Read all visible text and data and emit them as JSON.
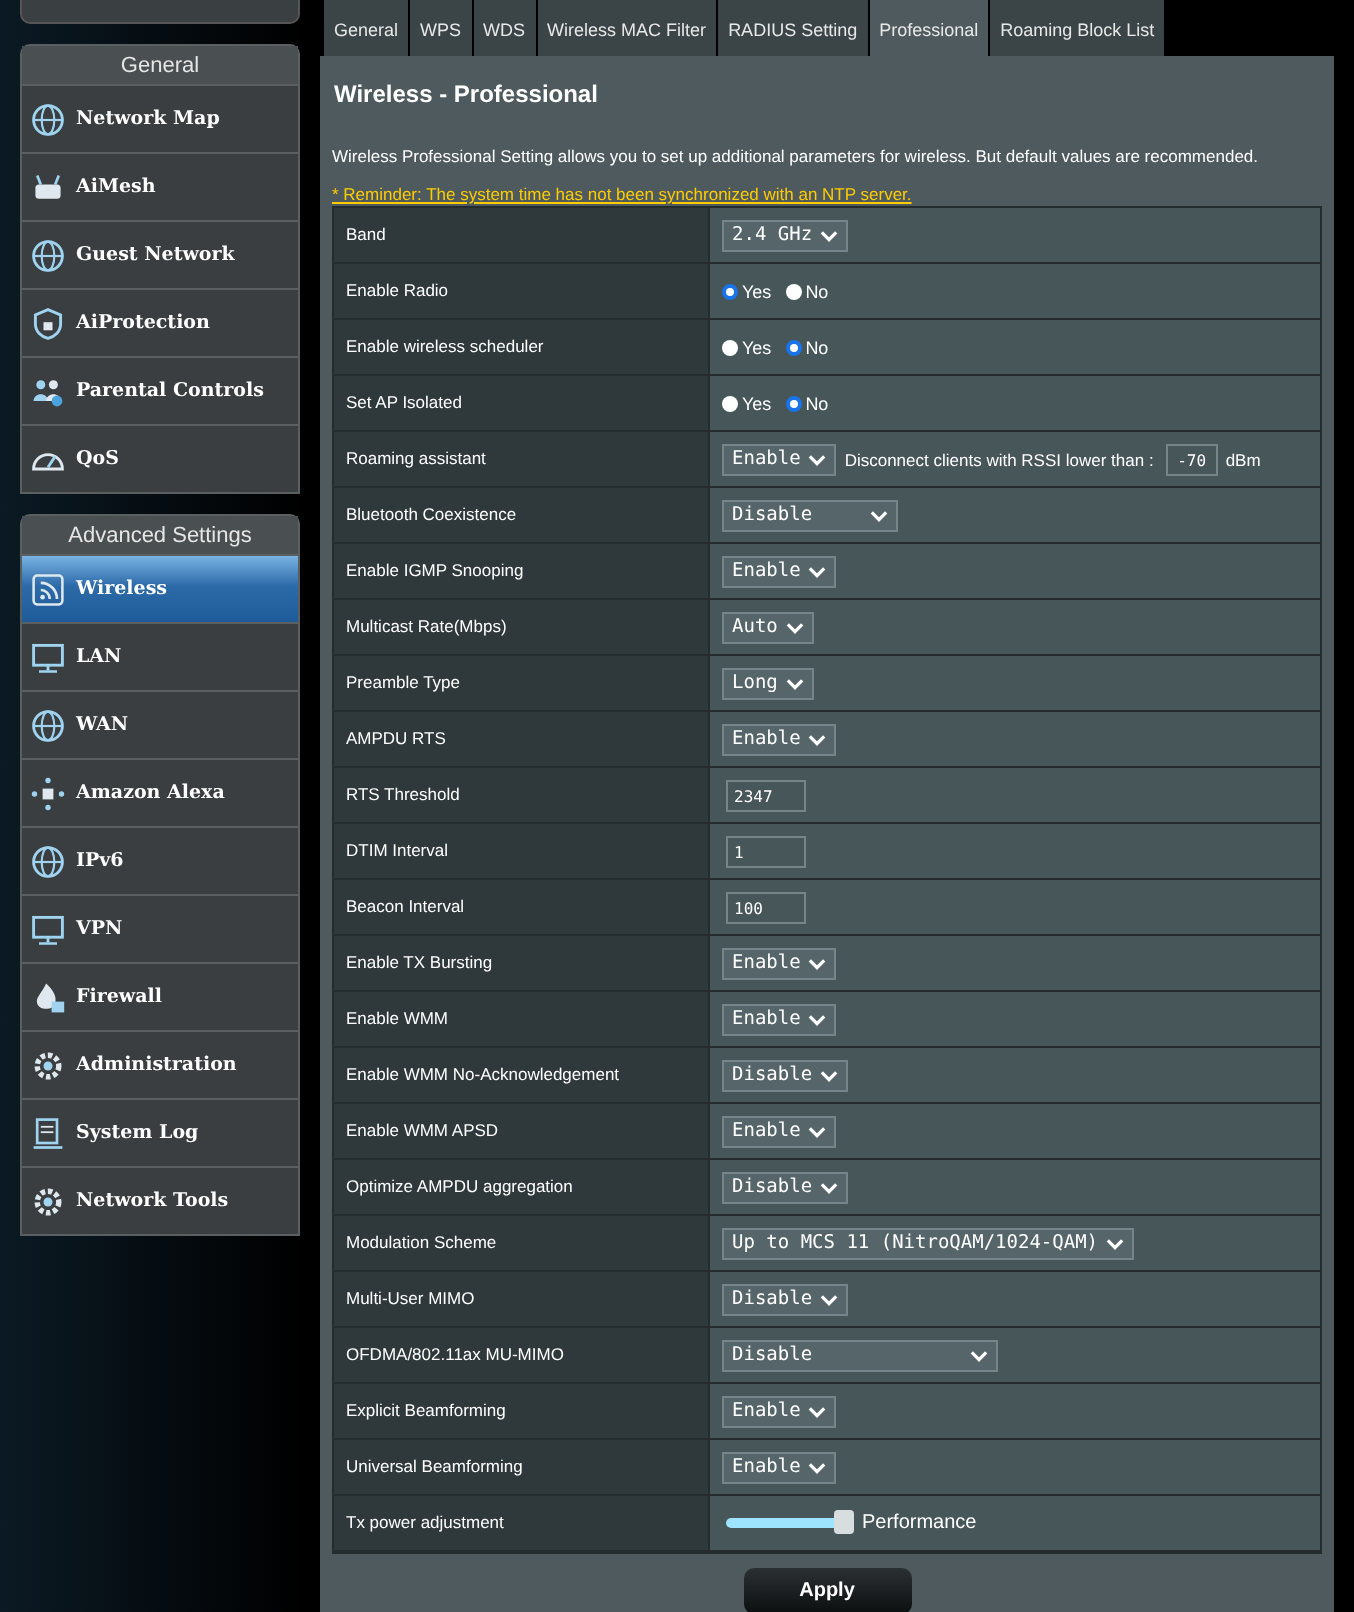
{
  "sidebar": {
    "groups": [
      {
        "title": "General",
        "items": [
          {
            "label": "Network Map",
            "selected": false
          },
          {
            "label": "AiMesh",
            "selected": false
          },
          {
            "label": "Guest Network",
            "selected": false
          },
          {
            "label": "AiProtection",
            "selected": false
          },
          {
            "label": "Parental Controls",
            "selected": false
          },
          {
            "label": "QoS",
            "selected": false
          }
        ]
      },
      {
        "title": "Advanced Settings",
        "items": [
          {
            "label": "Wireless",
            "selected": true
          },
          {
            "label": "LAN",
            "selected": false
          },
          {
            "label": "WAN",
            "selected": false
          },
          {
            "label": "Amazon Alexa",
            "selected": false
          },
          {
            "label": "IPv6",
            "selected": false
          },
          {
            "label": "VPN",
            "selected": false
          },
          {
            "label": "Firewall",
            "selected": false
          },
          {
            "label": "Administration",
            "selected": false
          },
          {
            "label": "System Log",
            "selected": false
          },
          {
            "label": "Network Tools",
            "selected": false
          }
        ]
      }
    ]
  },
  "tabs": [
    {
      "label": "General",
      "selected": false
    },
    {
      "label": "WPS",
      "selected": false
    },
    {
      "label": "WDS",
      "selected": false
    },
    {
      "label": "Wireless MAC Filter",
      "selected": false
    },
    {
      "label": "RADIUS Setting",
      "selected": false
    },
    {
      "label": "Professional",
      "selected": true
    },
    {
      "label": "Roaming Block List",
      "selected": false
    }
  ],
  "page": {
    "title": "Wireless - Professional",
    "description": "Wireless Professional Setting allows you to set up additional parameters for wireless. But default values are recommended.",
    "reminder": "* Reminder: The system time has not been synchronized with an NTP server."
  },
  "settings": [
    {
      "kind": "select",
      "label": "Band",
      "value": "2.4 GHz"
    },
    {
      "kind": "radio",
      "label": "Enable Radio",
      "options": [
        {
          "label": "Yes",
          "selected": true
        },
        {
          "label": "No",
          "selected": false
        }
      ]
    },
    {
      "kind": "radio",
      "label": "Enable wireless scheduler",
      "options": [
        {
          "label": "Yes",
          "selected": false
        },
        {
          "label": "No",
          "selected": true
        }
      ]
    },
    {
      "kind": "radio",
      "label": "Set AP Isolated",
      "options": [
        {
          "label": "Yes",
          "selected": false
        },
        {
          "label": "No",
          "selected": true
        }
      ]
    },
    {
      "kind": "roaming",
      "label": "Roaming assistant",
      "value": "Enable",
      "text": "Disconnect clients with RSSI lower than :",
      "input": "-70",
      "unit": "dBm"
    },
    {
      "kind": "select",
      "label": "Bluetooth Coexistence",
      "value": "Disable"
    },
    {
      "kind": "select",
      "label": "Enable IGMP Snooping",
      "value": "Enable"
    },
    {
      "kind": "select",
      "label": "Multicast Rate(Mbps)",
      "value": "Auto"
    },
    {
      "kind": "select",
      "label": "Preamble Type",
      "value": "Long"
    },
    {
      "kind": "select",
      "label": "AMPDU RTS",
      "value": "Enable"
    },
    {
      "kind": "input",
      "label": "RTS Threshold",
      "value": "2347"
    },
    {
      "kind": "input",
      "label": "DTIM Interval",
      "value": "1"
    },
    {
      "kind": "input",
      "label": "Beacon Interval",
      "value": "100"
    },
    {
      "kind": "select",
      "label": "Enable TX Bursting",
      "value": "Enable"
    },
    {
      "kind": "select",
      "label": "Enable WMM",
      "value": "Enable"
    },
    {
      "kind": "select",
      "label": "Enable WMM No-Acknowledgement",
      "value": "Disable"
    },
    {
      "kind": "select",
      "label": "Enable WMM APSD",
      "value": "Enable"
    },
    {
      "kind": "select",
      "label": "Optimize AMPDU aggregation",
      "value": "Disable"
    },
    {
      "kind": "select",
      "label": "Modulation Scheme",
      "value": "Up to MCS 11 (NitroQAM/1024-QAM)"
    },
    {
      "kind": "select",
      "label": "Multi-User MIMO",
      "value": "Disable"
    },
    {
      "kind": "select",
      "label": "OFDMA/802.11ax MU-MIMO",
      "value": "Disable"
    },
    {
      "kind": "select",
      "label": "Explicit Beamforming",
      "value": "Enable"
    },
    {
      "kind": "select",
      "label": "Universal Beamforming",
      "value": "Enable"
    },
    {
      "kind": "slider",
      "label": "Tx power adjustment",
      "level": 1,
      "text": "Performance"
    }
  ],
  "apply": "Apply"
}
